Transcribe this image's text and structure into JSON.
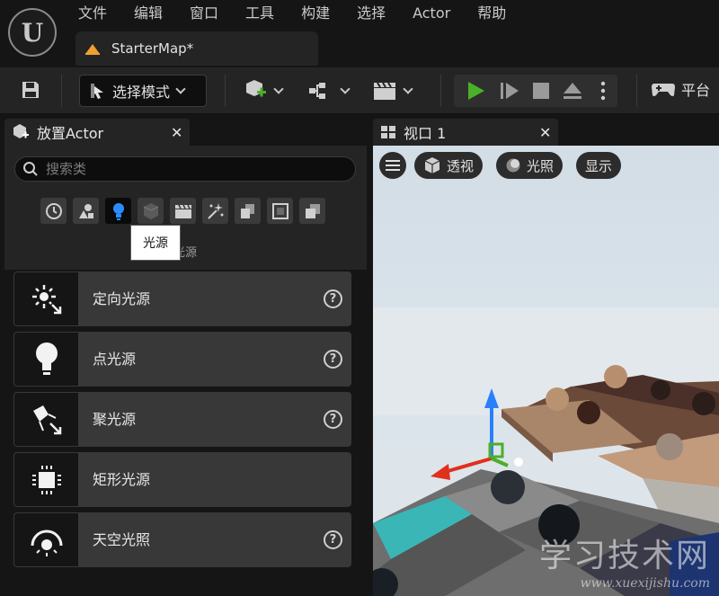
{
  "menu": [
    "文件",
    "编辑",
    "窗口",
    "工具",
    "构建",
    "选择",
    "Actor",
    "帮助"
  ],
  "doc_tab": {
    "title": "StarterMap*"
  },
  "toolbar": {
    "mode_label": "选择模式",
    "platform_label": "平台"
  },
  "place_actor": {
    "tab_title": "放置Actor",
    "search_placeholder": "搜索类",
    "categories": [
      "recent-icon",
      "shapes-icon",
      "lights-icon",
      "cube-icon",
      "cinematic-icon",
      "visual-effects-icon",
      "geometry-icon",
      "volumes-icon",
      "all-classes-icon"
    ],
    "active_category": "lights-icon",
    "category_label_partial": "光源",
    "tooltip": "光源",
    "items": [
      {
        "label": "定向光源",
        "icon": "directional-light-icon",
        "has_help": true
      },
      {
        "label": "点光源",
        "icon": "point-light-icon",
        "has_help": true
      },
      {
        "label": "聚光源",
        "icon": "spot-light-icon",
        "has_help": true
      },
      {
        "label": "矩形光源",
        "icon": "rect-light-icon",
        "has_help": false
      },
      {
        "label": "天空光照",
        "icon": "sky-light-icon",
        "has_help": true
      }
    ],
    "help_glyph": "?"
  },
  "viewport": {
    "tab_title": "视口 1",
    "perspective_label": "透视",
    "lit_label": "光照",
    "show_label": "显示"
  },
  "watermark": {
    "line1": "学习技术网",
    "line2": "www.xuexijishu.com"
  },
  "colors": {
    "play_green": "#4caf2a",
    "accent_blue": "#2a7fff",
    "panel_bg": "#242424"
  }
}
